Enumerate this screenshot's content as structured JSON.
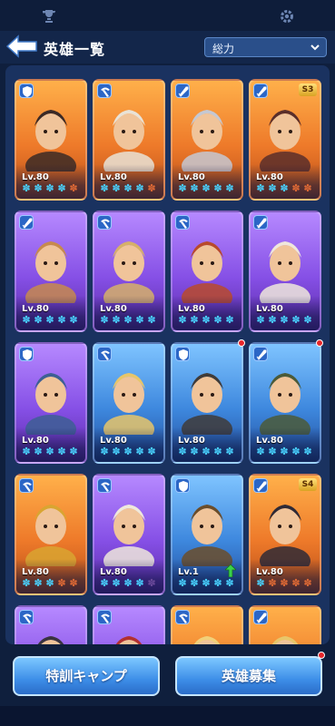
{
  "header": {
    "title": "英雄一覧",
    "sort_label": "総力"
  },
  "buttons": {
    "training_camp": "特訓キャンプ",
    "recruit": "英雄募集"
  },
  "heroes": [
    {
      "level": "Lv.80",
      "role": "shield",
      "stars_on": 4,
      "stars_off": 1,
      "bg": "orange"
    },
    {
      "level": "Lv.80",
      "role": "pickaxe",
      "stars_on": 4,
      "stars_off": 1,
      "bg": "orange"
    },
    {
      "level": "Lv.80",
      "role": "sword",
      "stars_on": 5,
      "stars_off": 0,
      "bg": "orange"
    },
    {
      "level": "Lv.80",
      "role": "sword",
      "stars_on": 3,
      "stars_off": 2,
      "bg": "orange",
      "badge": "S3"
    },
    {
      "level": "Lv.80",
      "role": "sword",
      "stars_on": 5,
      "stars_off": 0,
      "bg": "purple"
    },
    {
      "level": "Lv.80",
      "role": "pickaxe",
      "stars_on": 5,
      "stars_off": 0,
      "bg": "purple"
    },
    {
      "level": "Lv.80",
      "role": "pickaxe",
      "stars_on": 5,
      "stars_off": 0,
      "bg": "purple"
    },
    {
      "level": "Lv.80",
      "role": "sword",
      "stars_on": 5,
      "stars_off": 0,
      "bg": "purple"
    },
    {
      "level": "Lv.80",
      "role": "shield",
      "stars_on": 5,
      "stars_off": 0,
      "bg": "purple"
    },
    {
      "level": "Lv.80",
      "role": "pickaxe",
      "stars_on": 5,
      "stars_off": 0,
      "bg": "blue"
    },
    {
      "level": "Lv.80",
      "role": "shield",
      "stars_on": 5,
      "stars_off": 0,
      "bg": "blue",
      "dot": true
    },
    {
      "level": "Lv.80",
      "role": "sword",
      "stars_on": 5,
      "stars_off": 0,
      "bg": "blue",
      "dot": true
    },
    {
      "level": "Lv.80",
      "role": "pickaxe",
      "stars_on": 3,
      "stars_off": 2,
      "bg": "orange"
    },
    {
      "level": "Lv.80",
      "role": "pickaxe",
      "stars_on": 4,
      "stars_off": 1,
      "bg": "purple"
    },
    {
      "level": "Lv.1",
      "role": "shield",
      "stars_on": 5,
      "stars_off": 0,
      "bg": "blue",
      "up": true
    },
    {
      "level": "Lv.80",
      "role": "sword",
      "stars_on": 1,
      "stars_off": 4,
      "bg": "orange",
      "badge": "S4"
    },
    {
      "level": "",
      "role": "pickaxe",
      "stars_on": 0,
      "stars_off": 0,
      "bg": "purple"
    },
    {
      "level": "",
      "role": "pickaxe",
      "stars_on": 0,
      "stars_off": 0,
      "bg": "purple"
    },
    {
      "level": "",
      "role": "pickaxe",
      "stars_on": 0,
      "stars_off": 0,
      "bg": "orange"
    },
    {
      "level": "",
      "role": "sword",
      "stars_on": 0,
      "stars_off": 0,
      "bg": "orange"
    }
  ],
  "colors": {
    "background": "#0f1f3d",
    "panel": "#1a3260",
    "star_on": "#49d2ff",
    "star_off": "#e06a35",
    "button": "#3d8ee8"
  }
}
